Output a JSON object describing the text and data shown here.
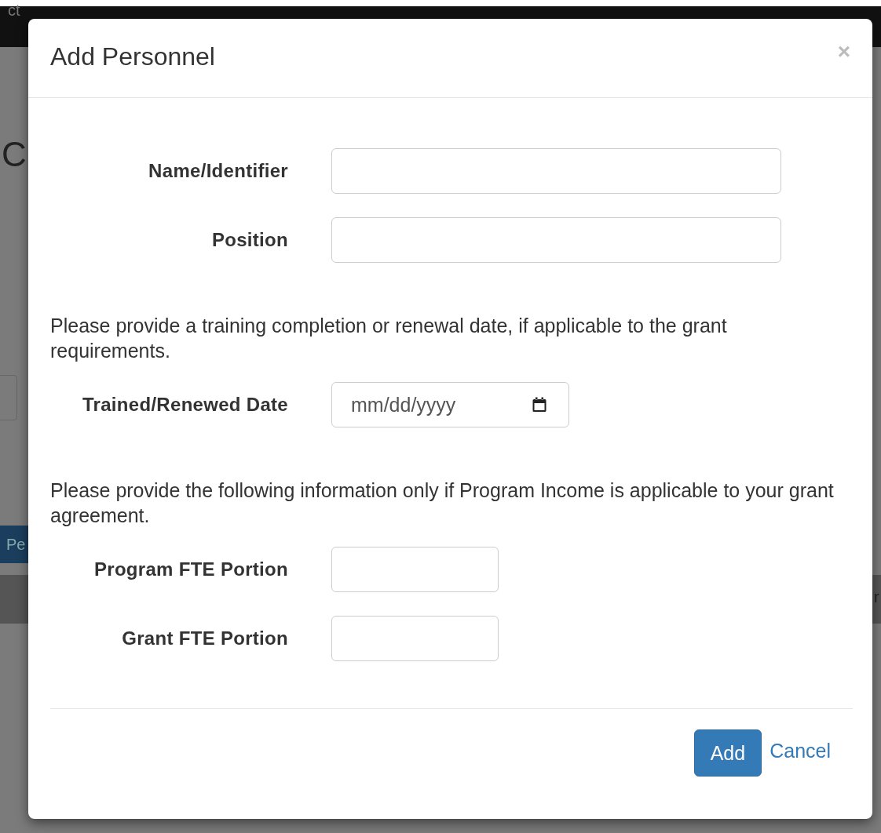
{
  "background": {
    "header_text": "ct",
    "heading": "C",
    "button": "Pe",
    "band_text": "r"
  },
  "modal": {
    "title": "Add Personnel",
    "close": "×",
    "body": [
      {
        "kind": "text_field",
        "label": "Name/Identifier"
      },
      {
        "kind": "text_field",
        "label": "Position"
      },
      {
        "kind": "note",
        "text": "Please provide a training completion or renewal date, if applicable to the grant requirements."
      },
      {
        "kind": "date_field",
        "label": "Trained/Renewed Date",
        "placeholder": "mm/dd/yyyy"
      },
      {
        "kind": "note",
        "text": "Please provide the following information only if Program Income is applicable to your grant agreement."
      },
      {
        "kind": "short_field",
        "label": "Program FTE Portion"
      },
      {
        "kind": "short_field",
        "label": "Grant FTE Portion"
      }
    ],
    "buttons": [
      {
        "kind": "primary",
        "label": "Add"
      },
      {
        "kind": "link",
        "label": "Cancel"
      }
    ]
  }
}
